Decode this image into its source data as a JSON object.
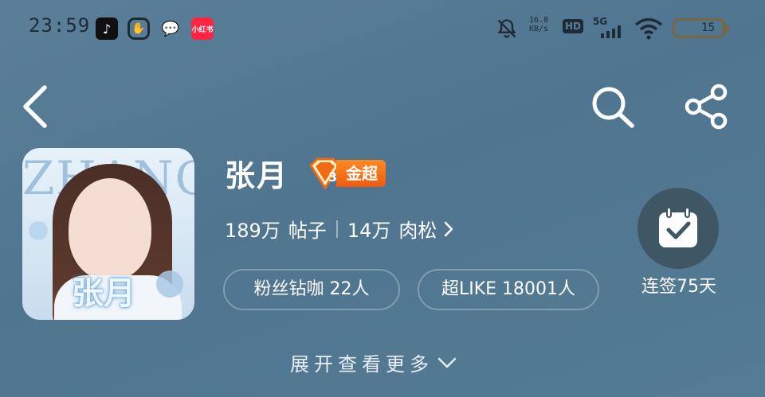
{
  "status_bar": {
    "time": "23:59",
    "network_speed_value": "16.8",
    "network_speed_unit": "KB/s",
    "hd_label": "HD",
    "signal_label": "5G",
    "battery_level": "15",
    "xhs_label": "小红书"
  },
  "navigation": {
    "back_icon": "chevron-left-icon",
    "search_icon": "search-icon",
    "share_icon": "share-icon"
  },
  "profile": {
    "name": "张月",
    "avatar_title_text": "ZHANG",
    "avatar_name_text": "张月",
    "badge_label": "金超",
    "badge_icon_text": "3",
    "stats": {
      "posts_value": "189万",
      "posts_label": "帖子",
      "rousong_value": "14万",
      "rousong_label": "肉松"
    },
    "fans_pill": "粉丝钻咖 22人",
    "like_pill": "超LIKE 18001人"
  },
  "checkin": {
    "icon": "calendar-check-icon",
    "label": "连签75天"
  },
  "expand": {
    "label": "展开查看更多"
  },
  "colors": {
    "background": "#547b94",
    "badge": "#f26a14",
    "checkin_circle": "#3f5664"
  }
}
